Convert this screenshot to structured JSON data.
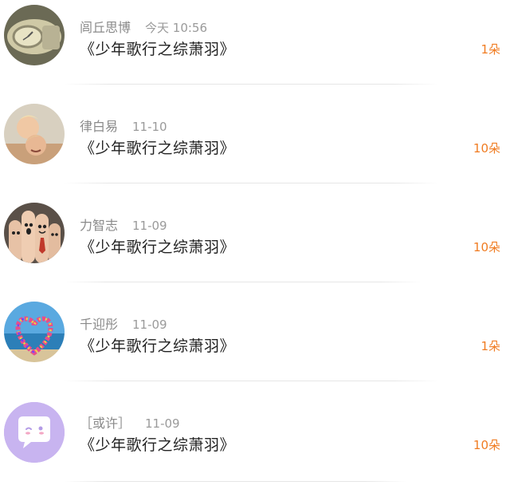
{
  "records": [
    {
      "name": "闾丘思博",
      "date": "今天 10:56",
      "title": "《少年歌行之综萧羽》",
      "count": "1朵"
    },
    {
      "name": "律白易",
      "date": "11-10",
      "title": "《少年歌行之综萧羽》",
      "count": "10朵"
    },
    {
      "name": "力智志",
      "date": "11-09",
      "title": "《少年歌行之综萧羽》",
      "count": "10朵"
    },
    {
      "name": "千迎彤",
      "date": "11-09",
      "title": "《少年歌行之综萧羽》",
      "count": "1朵"
    },
    {
      "name": "［或许］",
      "date": "11-09",
      "title": "《少年歌行之综萧羽》",
      "count": "10朵"
    }
  ],
  "colors": {
    "count": "#f07c22",
    "name": "#8a8a8a",
    "title": "#222222",
    "default_avatar": "#c8b4f0"
  }
}
